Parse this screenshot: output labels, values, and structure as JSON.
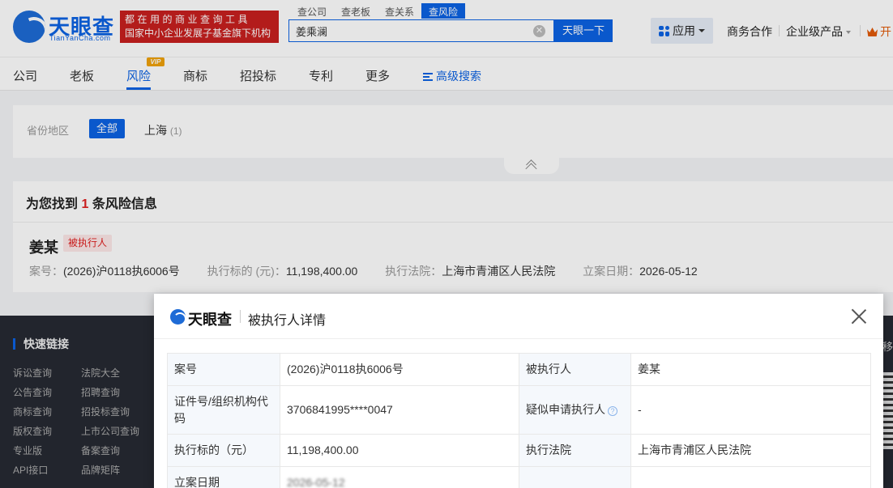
{
  "header": {
    "logo_cn": "天眼查",
    "logo_en": "TianYanCha.com",
    "slogan_line1": "都在用的商业查询工具",
    "slogan_line2": "国家中小企业发展子基金旗下机构",
    "search_tabs": [
      "查公司",
      "查老板",
      "查关系",
      "查风险"
    ],
    "search_value": "姜乘澜",
    "search_button": "天眼一下",
    "apps_label": "应用",
    "business_link": "商务合作",
    "enterprise_link": "企业级产品",
    "open_link": "开"
  },
  "nav": {
    "items": [
      "公司",
      "老板",
      "风险",
      "商标",
      "招投标",
      "专利",
      "更多"
    ],
    "vip_tag": "VIP",
    "advanced_search": "高级搜索"
  },
  "filter": {
    "label": "省份地区",
    "all": "全部",
    "option": "上海",
    "option_count": "(1)"
  },
  "result": {
    "summary_prefix": "为您找到",
    "summary_count": "1",
    "summary_suffix": "条风险信息",
    "name": "姜某",
    "tag": "被执行人",
    "case_no_label": "案号：",
    "case_no": "(2026)沪0118执6006号",
    "amount_label": "执行标的 (元)：",
    "amount": "11,198,400.00",
    "court_label": "执行法院：",
    "court": "上海市青浦区人民法院",
    "date_label": "立案日期：",
    "date": "2026-05-12"
  },
  "footer": {
    "title": "快速链接",
    "links_col1": [
      "诉讼查询",
      "公告查询",
      "商标查询",
      "版权查询",
      "专业版",
      "API接口"
    ],
    "links_col2": [
      "法院大全",
      "招聘查询",
      "招投标查询",
      "上市公司查询",
      "备案查询",
      "品牌矩阵"
    ],
    "edge_text": "移"
  },
  "modal": {
    "logo_text": "天眼查",
    "title": "被执行人详情",
    "rows": [
      {
        "k1": "案号",
        "v1": "(2026)沪0118执6006号",
        "k2": "被执行人",
        "v2": "姜某"
      },
      {
        "k1": "证件号/组织机构代码",
        "v1": "3706841995****0047",
        "k2": "疑似申请执行人",
        "v2": "-"
      },
      {
        "k1": "执行标的（元）",
        "v1": "11,198,400.00",
        "k2": "执行法院",
        "v2": "上海市青浦区人民法院"
      },
      {
        "k1": "立案日期",
        "v1": "2026-05-12",
        "k2": "",
        "v2": ""
      }
    ]
  },
  "colors": {
    "brand_blue": "#0c63e4",
    "slogan_red": "#c8201f",
    "danger_red": "#e02020",
    "vip_orange": "#f0a20b",
    "footer_bg": "#262a33"
  }
}
